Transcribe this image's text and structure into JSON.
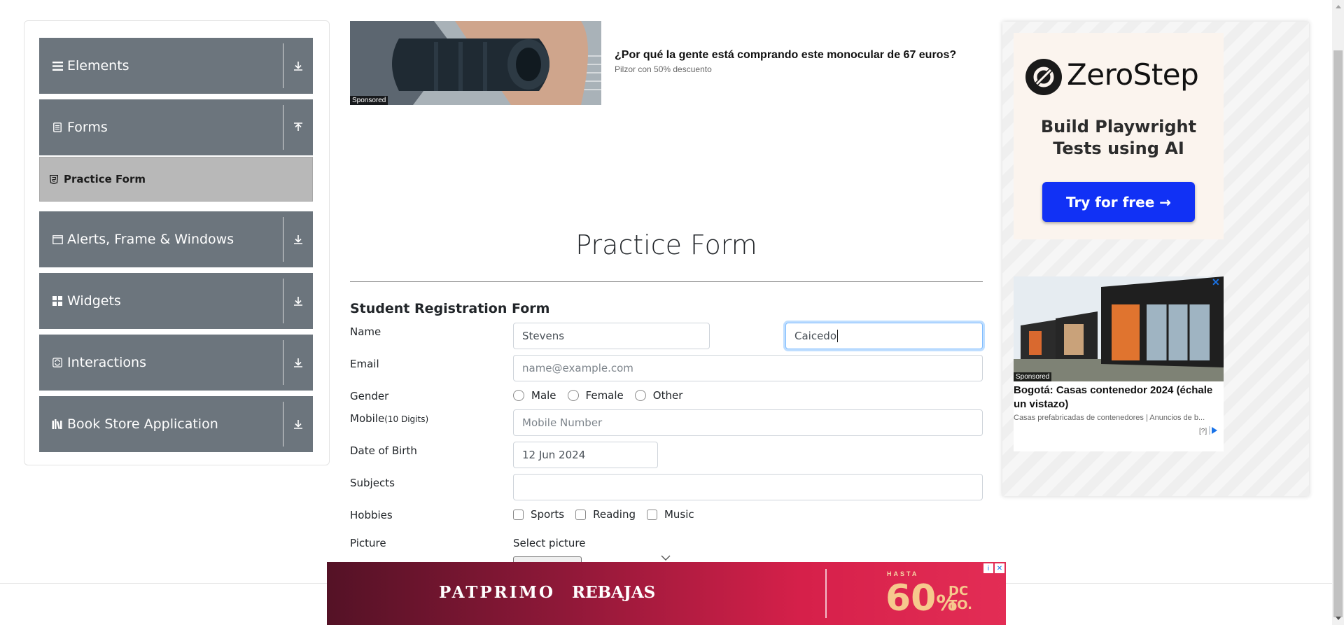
{
  "sidebar": {
    "groups": [
      {
        "label": "Elements",
        "icon": "hamburger-icon",
        "arrow": "download-arrow-icon"
      },
      {
        "label": "Forms",
        "icon": "document-icon",
        "arrow": "upload-arrow-icon"
      },
      {
        "label": "Alerts, Frame & Windows",
        "icon": "window-icon",
        "arrow": "download-arrow-icon"
      },
      {
        "label": "Widgets",
        "icon": "grid-icon",
        "arrow": "download-arrow-icon"
      },
      {
        "label": "Interactions",
        "icon": "interactions-icon",
        "arrow": "download-arrow-icon"
      },
      {
        "label": "Book Store Application",
        "icon": "books-icon",
        "arrow": "download-arrow-icon"
      }
    ],
    "active_item": {
      "label": "Practice Form",
      "icon": "html5-icon"
    }
  },
  "top_ad": {
    "sponsored": "Sponsored",
    "title": "¿Por qué la gente está comprando este monocular de 67 euros?",
    "subtitle": "Pilzor con 50% descuento"
  },
  "form": {
    "page_title": "Practice Form",
    "heading": "Student Registration Form",
    "name_label": "Name",
    "first_name_value": "Stevens",
    "last_name_value": "Caicedo",
    "email_label": "Email",
    "email_placeholder": "name@example.com",
    "gender_label": "Gender",
    "gender_options": [
      "Male",
      "Female",
      "Other"
    ],
    "mobile_label": "Mobile",
    "mobile_hint": "(10 Digits)",
    "mobile_placeholder": "Mobile Number",
    "dob_label": "Date of Birth",
    "dob_value": "12 Jun 2024",
    "subjects_label": "Subjects",
    "subjects_value": "",
    "hobbies_label": "Hobbies",
    "hobby_options": [
      "Sports",
      "Reading",
      "Music"
    ],
    "picture_label": "Picture",
    "picture_prompt": "Select picture"
  },
  "right_ad": {
    "brand": "ZeroStep",
    "headline": "Build Playwright Tests using AI",
    "cta": "Try for free →"
  },
  "house_ad": {
    "sponsored": "Sponsored",
    "close": "✕",
    "title": "Bogotá: Casas contenedor 2024 (échale un vistazo)",
    "subtitle": "Casas prefabricadas de contenedores | Anuncios de b...",
    "adchoice": "[?]"
  },
  "bottom_ad": {
    "brand": "PATPRIMO",
    "promo": "REBAJAS",
    "hasta": "HASTA",
    "discount": "60",
    "percent": "%",
    "suffix_1": "DC",
    "suffix_2": "TO."
  },
  "colors": {
    "sidebar_header": "#6c757d",
    "sidebar_active": "#b8b8b8",
    "focus_border": "#80bdff",
    "cta_blue": "#1131f5"
  }
}
